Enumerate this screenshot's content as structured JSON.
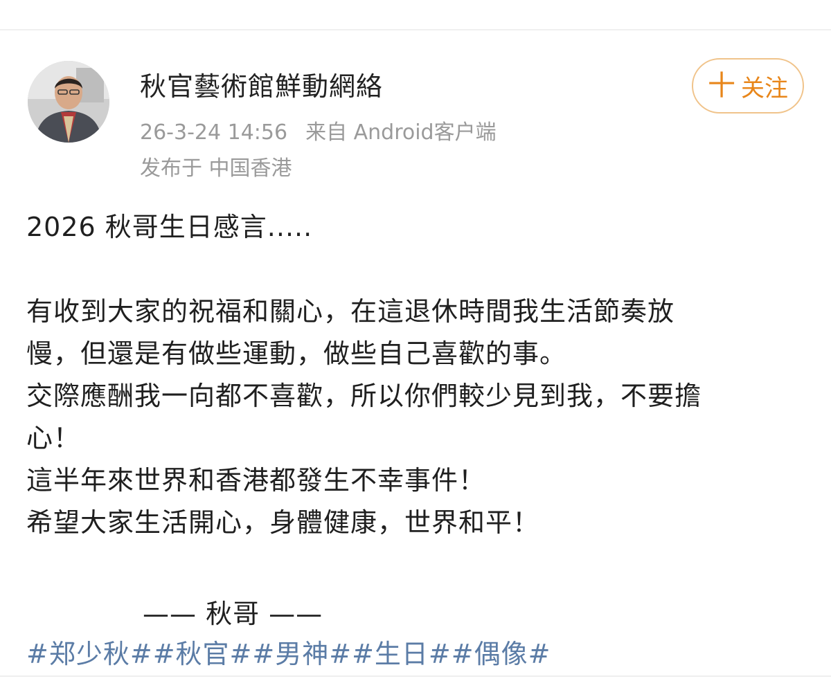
{
  "post": {
    "author": {
      "name": "秋官藝術館鮮動網絡",
      "avatar_icon": "profile-photo"
    },
    "timestamp": "26-3-24 14:56",
    "source": "来自 Android客户端",
    "location": "发布于 中国香港",
    "follow": {
      "plus": "十",
      "label": "关注",
      "color": "#e8861a"
    },
    "body": {
      "title": "2026 秋哥生日感言.....",
      "paragraph_lines": [
        "有收到大家的祝福和關心，在這退休時間我生活節奏放",
        "慢，但還是有做些運動，做些自己喜歡的事。",
        "交際應酬我一向都不喜歡，所以你們較少見到我，不要擔",
        "心！",
        "這半年來世界和香港都發生不幸事件！",
        "希望大家生活開心，身體健康，世界和平！"
      ],
      "signature": "—— 秋哥 ——"
    },
    "hashtags": [
      "#郑少秋#",
      "#秋官#",
      "#男神#",
      "#生日#",
      "#偶像#"
    ],
    "hashtag_color": "#5b7ca6"
  }
}
